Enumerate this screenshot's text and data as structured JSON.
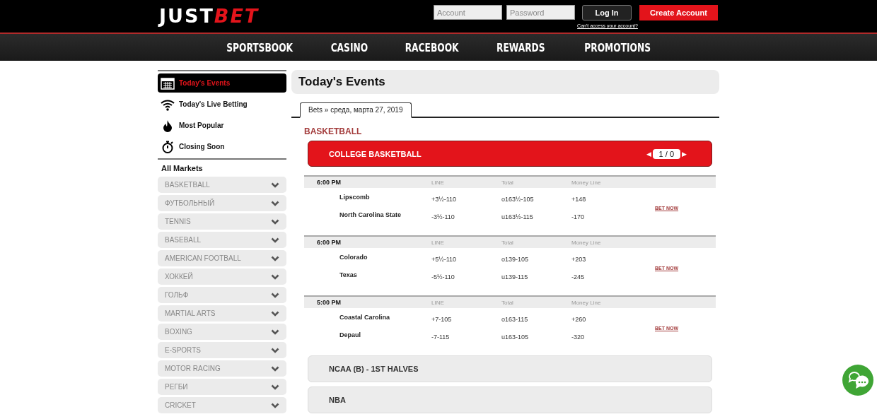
{
  "header": {
    "logo": [
      "JUST",
      "BET"
    ],
    "account_placeholder": "Account",
    "password_placeholder": "Password",
    "login": "Log In",
    "create": "Create Account",
    "forgot": "Can't access your account?"
  },
  "nav": [
    "SPORTSBOOK",
    "CASINO",
    "RACEBOOK",
    "REWARDS",
    "PROMOTIONS"
  ],
  "sidebar": {
    "quick_links": [
      {
        "label": "Today's Events",
        "kind": "calendar",
        "selected": true
      },
      {
        "label": "Today's Live Betting",
        "kind": "wifi",
        "selected": false
      },
      {
        "label": "Most Popular",
        "kind": "flame",
        "selected": false
      },
      {
        "label": "Closing Soon",
        "kind": "stopwatch",
        "selected": false
      }
    ],
    "markets_title": "All Markets",
    "markets": [
      "BASKETBALL",
      "ФУТБОЛЬНЫЙ",
      "TENNIS",
      "BASEBALL",
      "AMERICAN FOOTBALL",
      "ХОККЕЙ",
      "ГОЛЬФ",
      "MARTIAL ARTS",
      "BOXING",
      "E-SPORTS",
      "MOTOR RACING",
      "РЕГБИ",
      "CRICKET"
    ]
  },
  "main": {
    "title": "Today's Events",
    "tab": "Bets » среда, марта 27, 2019",
    "sport": "BASKETBALL",
    "league": {
      "name": "COLLEGE BASKETBALL",
      "pager": "1 / 0",
      "prev": "◀",
      "next": "▶"
    },
    "events": [
      {
        "time": "6:00 PM",
        "columns": [
          "LINE",
          "Total",
          "Money Line"
        ],
        "bet": "BET NOW",
        "teams": [
          {
            "name": "Lipscomb",
            "line": "+3½-110",
            "total": "o163½-105",
            "money": "+148"
          },
          {
            "name": "North Carolina State",
            "line": "-3½-110",
            "total": "u163½-115",
            "money": "-170"
          }
        ]
      },
      {
        "time": "6:00 PM",
        "columns": [
          "LINE",
          "Total",
          "Money Line"
        ],
        "bet": "BET NOW",
        "teams": [
          {
            "name": "Colorado",
            "line": "+5½-110",
            "total": "o139-105",
            "money": "+203"
          },
          {
            "name": "Texas",
            "line": "-5½-110",
            "total": "u139-115",
            "money": "-245"
          }
        ]
      },
      {
        "time": "5:00 PM",
        "columns": [
          "LINE",
          "Total",
          "Money Line"
        ],
        "bet": "BET NOW",
        "teams": [
          {
            "name": "Coastal Carolina",
            "line": "+7-105",
            "total": "o163-115",
            "money": "+260"
          },
          {
            "name": "Depaul",
            "line": "-7-115",
            "total": "u163-105",
            "money": "-320"
          }
        ]
      }
    ],
    "other_leagues": [
      "NCAA (B) - 1ST HALVES",
      "NBA"
    ]
  }
}
